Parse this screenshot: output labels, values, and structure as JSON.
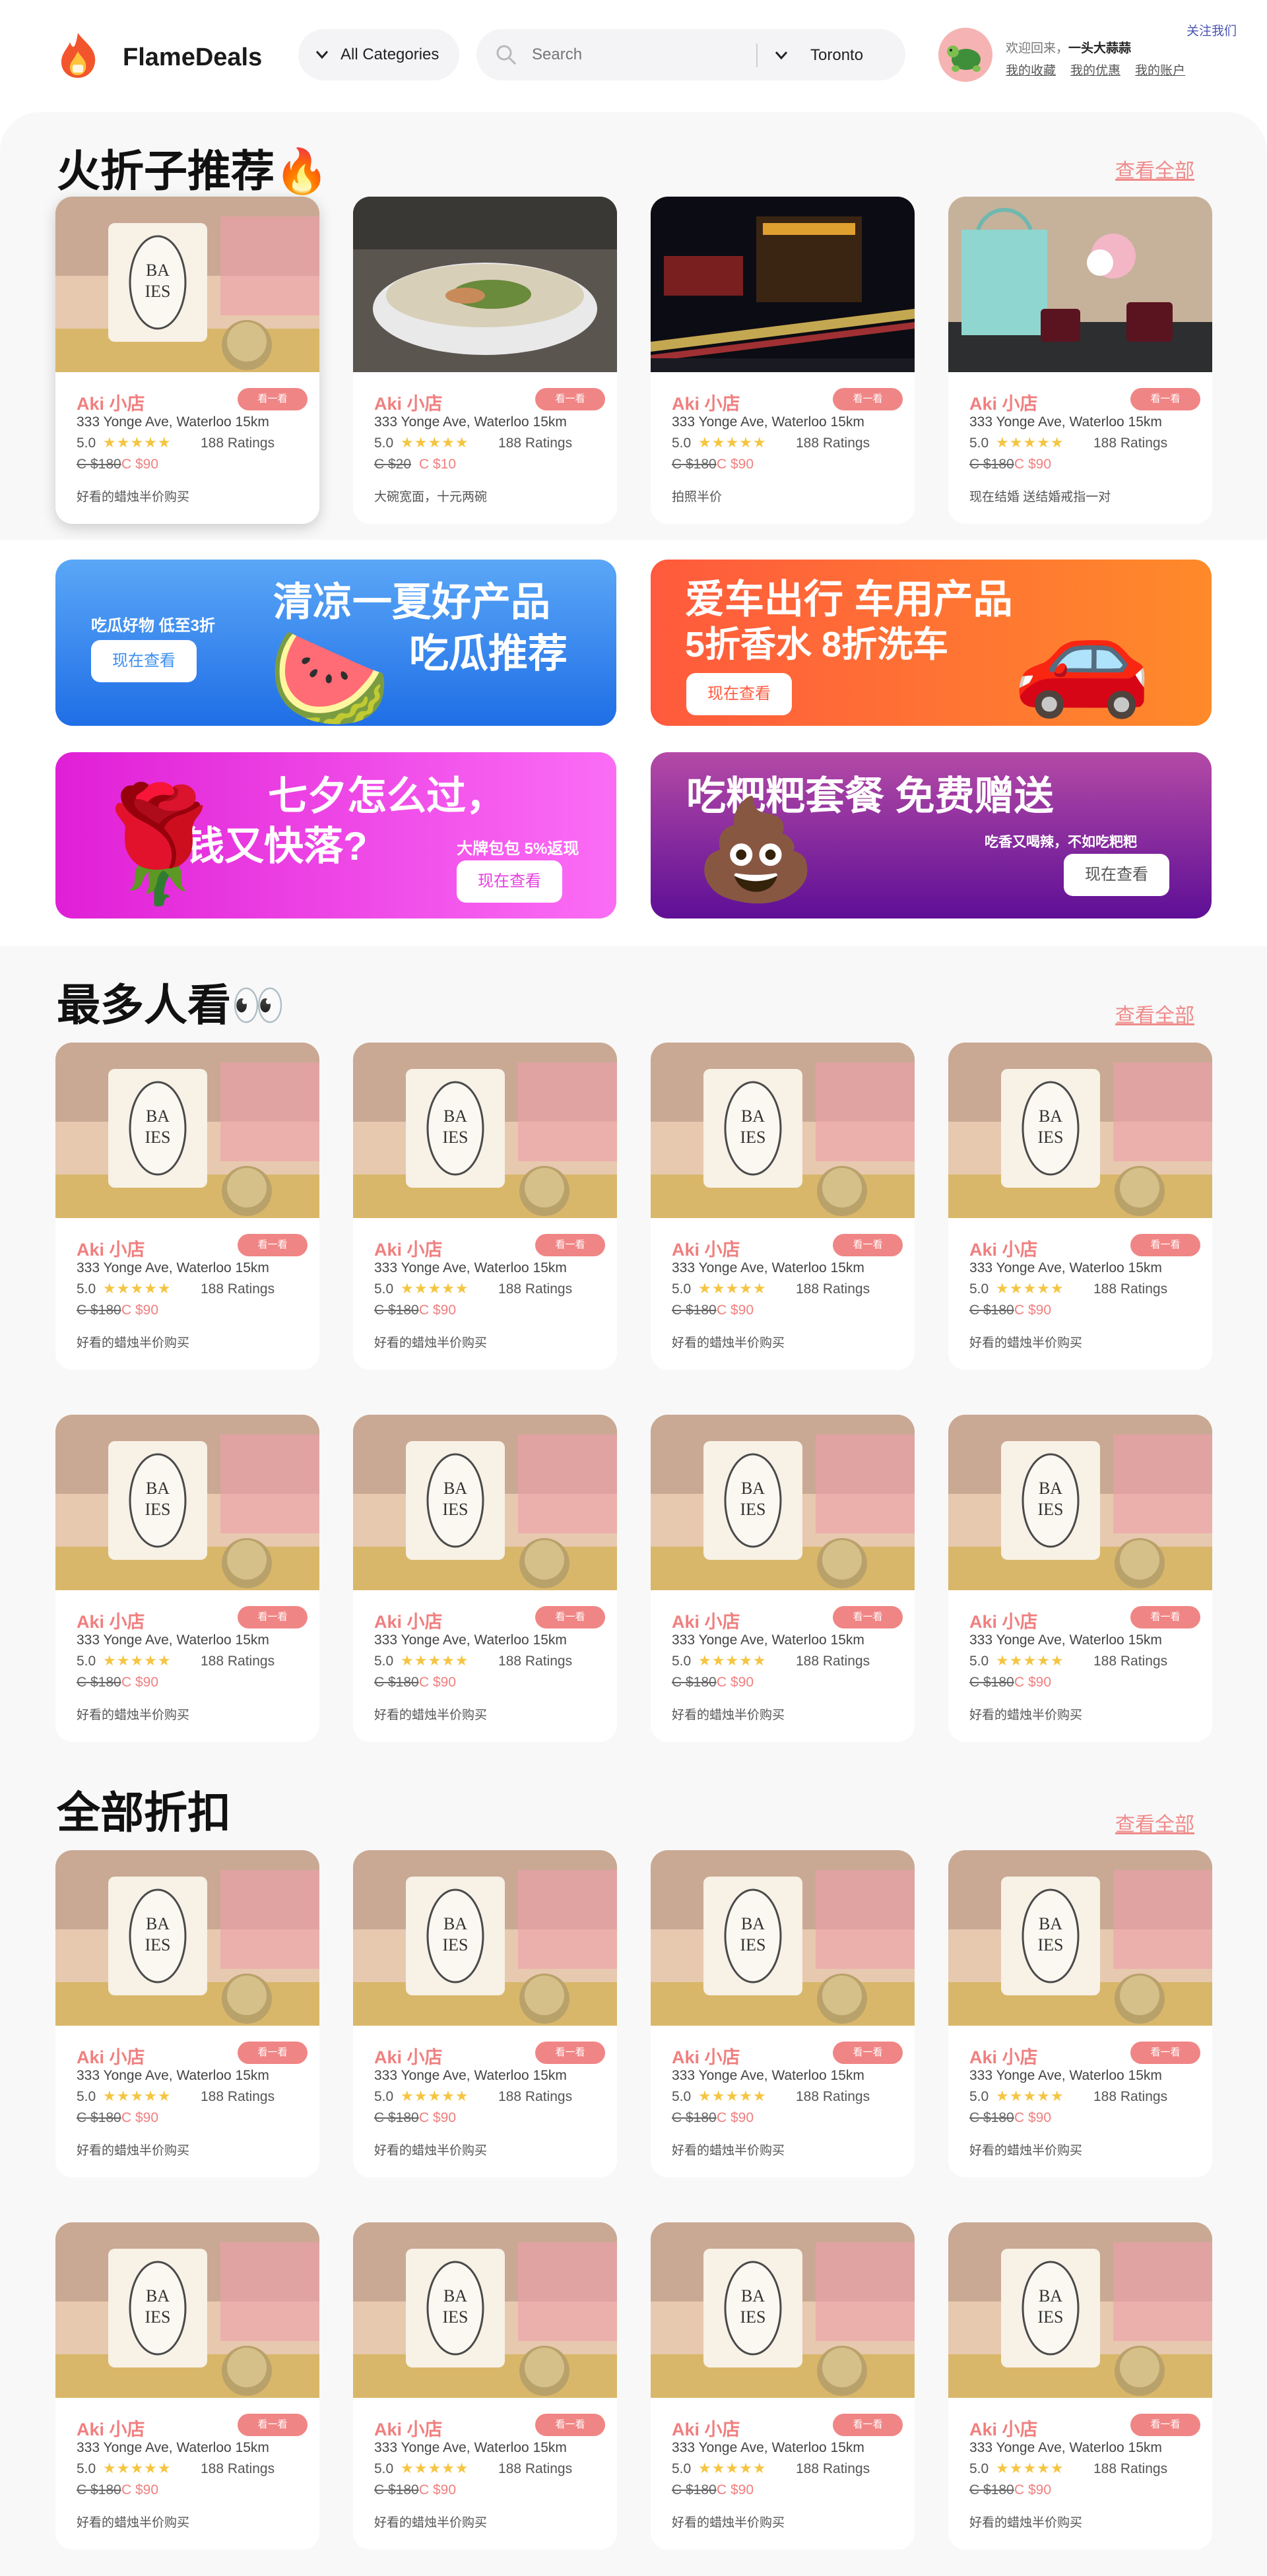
{
  "header": {
    "brand": "FlameDeals",
    "categories_label": "All Categories",
    "search_placeholder": "Search",
    "location": "Toronto",
    "welcome_prefix": "欢迎回来，",
    "username": "一头大蒜蒜",
    "links": [
      "我的收藏",
      "我的优惠",
      "我的账户"
    ],
    "follow": "关注我们"
  },
  "sections": {
    "featured": {
      "title": "火折子推荐",
      "emoji": "🔥",
      "see_all": "查看全部"
    },
    "popular": {
      "title": "最多人看",
      "emoji": "👀",
      "see_all": "查看全部"
    },
    "all": {
      "title": "全部折扣",
      "see_all": "查看全部"
    }
  },
  "card_common": {
    "name": "Aki 小店",
    "button": "看一看",
    "address": "333 Yonge Ave, Waterloo 15km",
    "rating": "5.0",
    "stars": "★★★★★",
    "ratings_count": "188 Ratings"
  },
  "featured_cards": [
    {
      "old_price": "C $180",
      "new_price": "C $90",
      "desc": "好看的蜡烛半价购买",
      "image": "candle"
    },
    {
      "old_price": "C $20",
      "new_price": "C $10",
      "desc": "大碗宽面，十元两碗",
      "image": "noodles"
    },
    {
      "old_price": "C $180",
      "new_price": "C $90",
      "desc": "拍照半价",
      "image": "city-night"
    },
    {
      "old_price": "C $180",
      "new_price": "C $90",
      "desc": "现在结婚 送结婚戒指一对",
      "image": "tiffany"
    }
  ],
  "candle_card": {
    "old_price": "C $180",
    "new_price": "C $90",
    "desc": "好看的蜡烛半价购买"
  },
  "promos": [
    {
      "headline1": "清凉一夏好产品",
      "headline2": "吃瓜推荐",
      "sub": "吃瓜好物 低至3折",
      "cta": "现在查看",
      "emoji": "🍉",
      "color": "#2f80ed"
    },
    {
      "headline1": "爱车出行 车用产品",
      "headline2": "5折香水 8折洗车",
      "cta": "现在查看",
      "emoji": "🚗",
      "color": "#ff6b2c"
    },
    {
      "headline1": "七夕怎么过，",
      "headline2": "省钱又快落?",
      "sub": "大牌包包 5%返现",
      "cta": "现在查看",
      "emoji": "🌹",
      "color": "#ee2fe4"
    },
    {
      "headline1": "吃粑粑套餐 免费赠送",
      "sub": "吃香又喝辣，不如吃粑粑",
      "cta": "现在查看",
      "emoji": "💩",
      "color": "#7a1aa6"
    }
  ]
}
